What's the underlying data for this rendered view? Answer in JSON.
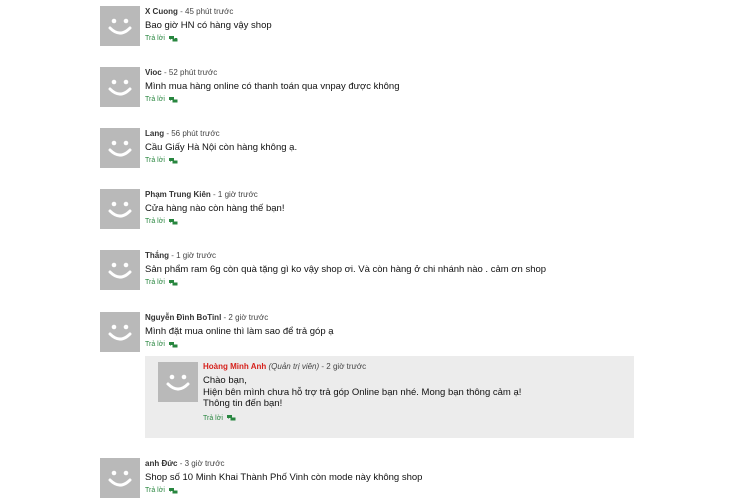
{
  "comments": [
    {
      "author": "X Cuong",
      "time": "45 phút trước",
      "text": "Bao giờ HN có hàng vậy shop",
      "reply_label": "Trả lời"
    },
    {
      "author": "Vioc",
      "time": "52 phút trước",
      "text": "Mình mua hàng online có thanh toán qua vnpay được không",
      "reply_label": "Trả lời"
    },
    {
      "author": "Lang",
      "time": "56 phút trước",
      "text": "Cầu Giấy Hà Nội còn hàng không ạ.",
      "reply_label": "Trả lời"
    },
    {
      "author": "Phạm Trung Kiên",
      "time": "1 giờ trước",
      "text": "Cửa hàng nào còn hàng thế bạn!",
      "reply_label": "Trả lời"
    },
    {
      "author": "Thắng",
      "time": "1 giờ trước",
      "text": "Sản phẩm ram 6g còn quà tặng gì ko vậy shop ơi. Và còn hàng ở chi nhánh nào . cảm ơn shop",
      "reply_label": "Trả lời"
    },
    {
      "author": "Nguyễn Đình BoTinl",
      "time": "2 giờ trước",
      "text": "Mình đặt mua online thì làm sao để trả góp ạ",
      "reply_label": "Trả lời"
    },
    {
      "author": "anh Đức",
      "time": "3 giờ trước",
      "text": "Shop số 10 Minh Khai Thành Phố Vinh còn mode này không shop",
      "reply_label": "Trả lời"
    }
  ],
  "admin_reply": {
    "author": "Hoàng Minh Anh",
    "role": "(Quản trị viên)",
    "time": "2 giờ trước",
    "lines": [
      "Chào bạn,",
      "Hiện bên mình chưa hỗ trợ trả góp Online bạn nhé. Mong bạn thông cảm ạ!",
      "Thông tin đến bạn!"
    ],
    "reply_label": "Trả lời"
  },
  "colors": {
    "reply_green": "#28863f",
    "admin_red": "#d6211c",
    "avatar_gray": "#b9b9b9",
    "admin_bg": "#ececec"
  },
  "icons": {
    "avatar": "smiley-avatar-icon",
    "reply": "speech-bubbles-icon"
  }
}
